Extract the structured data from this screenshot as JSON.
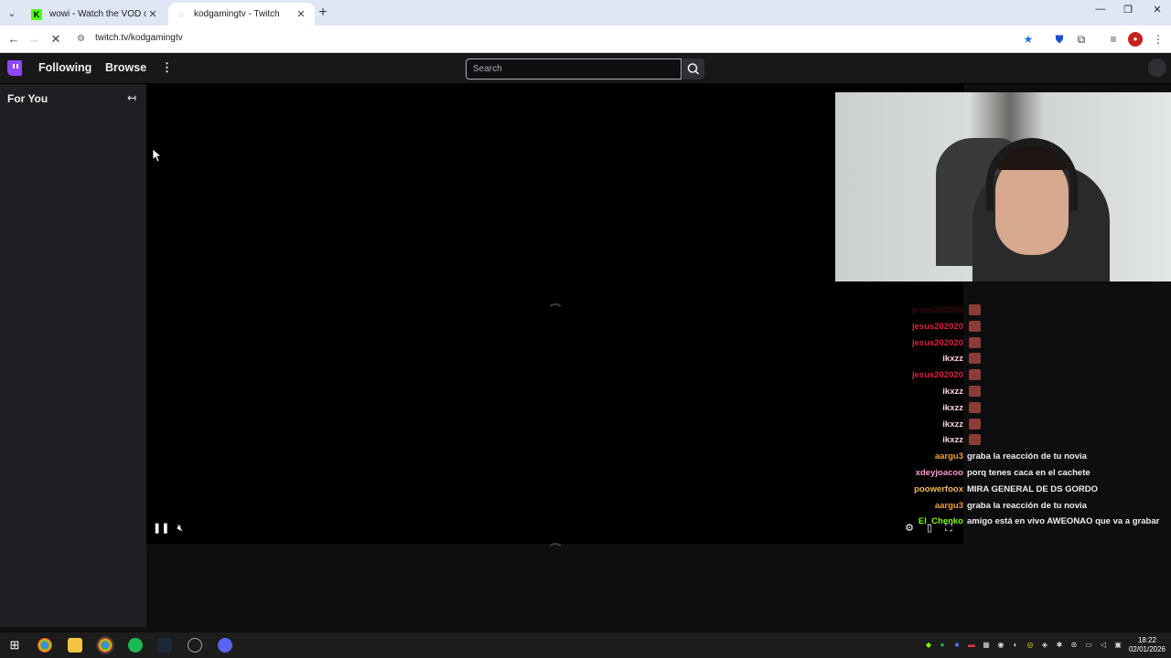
{
  "browser": {
    "tabs": [
      {
        "title": "wowi - Watch the VOD on Kick",
        "favicon": "kick-favicon",
        "active": false
      },
      {
        "title": "kodgamingtv - Twitch",
        "favicon": "twitch-favicon",
        "active": true
      }
    ],
    "new_tab": "+",
    "url": "twitch.tv/kodgamingtv"
  },
  "twitch": {
    "nav": {
      "following": "Following",
      "browse": "Browse",
      "more": "⋮",
      "search_placeholder": "Search"
    },
    "sidebar": {
      "title": "For You",
      "collapse": "↤"
    }
  },
  "chat": [
    {
      "user": "jesus202020",
      "color": "#3a0b10",
      "message": "",
      "emote": true
    },
    {
      "user": "jesus202020",
      "color": "#e0213f",
      "message": "",
      "emote": true
    },
    {
      "user": "jesus202020",
      "color": "#e0213f",
      "message": "",
      "emote": true
    },
    {
      "user": "ikxzz",
      "color": "#ffd1dc",
      "message": "",
      "emote": true
    },
    {
      "user": "jesus202020",
      "color": "#e0213f",
      "message": "",
      "emote": true
    },
    {
      "user": "ikxzz",
      "color": "#ffd1dc",
      "message": "",
      "emote": true
    },
    {
      "user": "ikxzz",
      "color": "#ffd1dc",
      "message": "",
      "emote": true
    },
    {
      "user": "ikxzz",
      "color": "#ffd1dc",
      "message": "",
      "emote": true
    },
    {
      "user": "ikxzz",
      "color": "#ffd1dc",
      "message": "",
      "emote": true
    },
    {
      "user": "aargu3",
      "color": "#f0a03a",
      "message": "graba la reacción de tu novia",
      "emote": false
    },
    {
      "user": "xdeyjoacoo",
      "color": "#ff9ad1",
      "message": "porq tenes caca en el cachete",
      "emote": false
    },
    {
      "user": "poowerfoox",
      "color": "#f5b85c",
      "message": "MIRA GENERAL DE DS GORDO",
      "emote": false
    },
    {
      "user": "aargu3",
      "color": "#f0a03a",
      "message": "graba la reacción de tu novia",
      "emote": false
    },
    {
      "user": "El_Chenko",
      "color": "#7cfc00",
      "message": "amigo está en vivo AWEONAO que va a grabar",
      "emote": false
    }
  ],
  "taskbar": {
    "time": "18:22",
    "date": "02/01/2026"
  },
  "colors": {
    "twitch_purple": "#9146ff",
    "twitch_bg": "#0e0e10",
    "sidebar_bg": "#1f1f23",
    "nav_bg": "#18181b"
  }
}
